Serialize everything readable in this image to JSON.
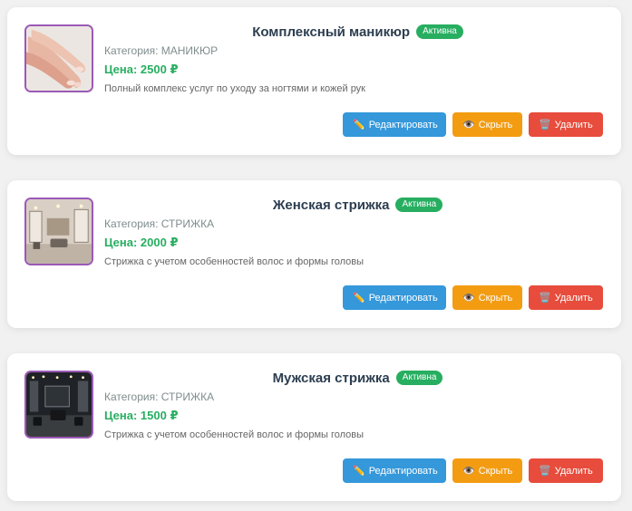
{
  "services": [
    {
      "title": "Комплексный маникюр",
      "status": "Активна",
      "category": "Категория: МАНИКЮР",
      "price": "Цена: 2500 ₽",
      "description": "Полный комплекс услуг по уходу за ногтями и кожей рук",
      "image": "manicure-hands-photo"
    },
    {
      "title": "Женская стрижка",
      "status": "Активна",
      "category": "Категория: СТРИЖКА",
      "price": "Цена: 2000 ₽",
      "description": "Стрижка с учетом особенностей волос и формы головы",
      "image": "salon-interior-photo"
    },
    {
      "title": "Мужская стрижка",
      "status": "Активна",
      "category": "Категория: СТРИЖКА",
      "price": "Цена: 1500 ₽",
      "description": "Стрижка с учетом особенностей волос и формы головы",
      "image": "barbershop-interior-photo"
    }
  ],
  "buttons": {
    "edit_icon": "✏️",
    "edit_label": "Редактировать",
    "hide_icon": "👁️",
    "hide_label": "Скрыть",
    "delete_icon": "🗑️",
    "delete_label": "Удалить"
  },
  "colors": {
    "accent_blue": "#3498db",
    "accent_orange": "#f39c12",
    "accent_red": "#e74c3c",
    "active_green": "#27ae60",
    "thumb_border": "#9b59b6"
  }
}
